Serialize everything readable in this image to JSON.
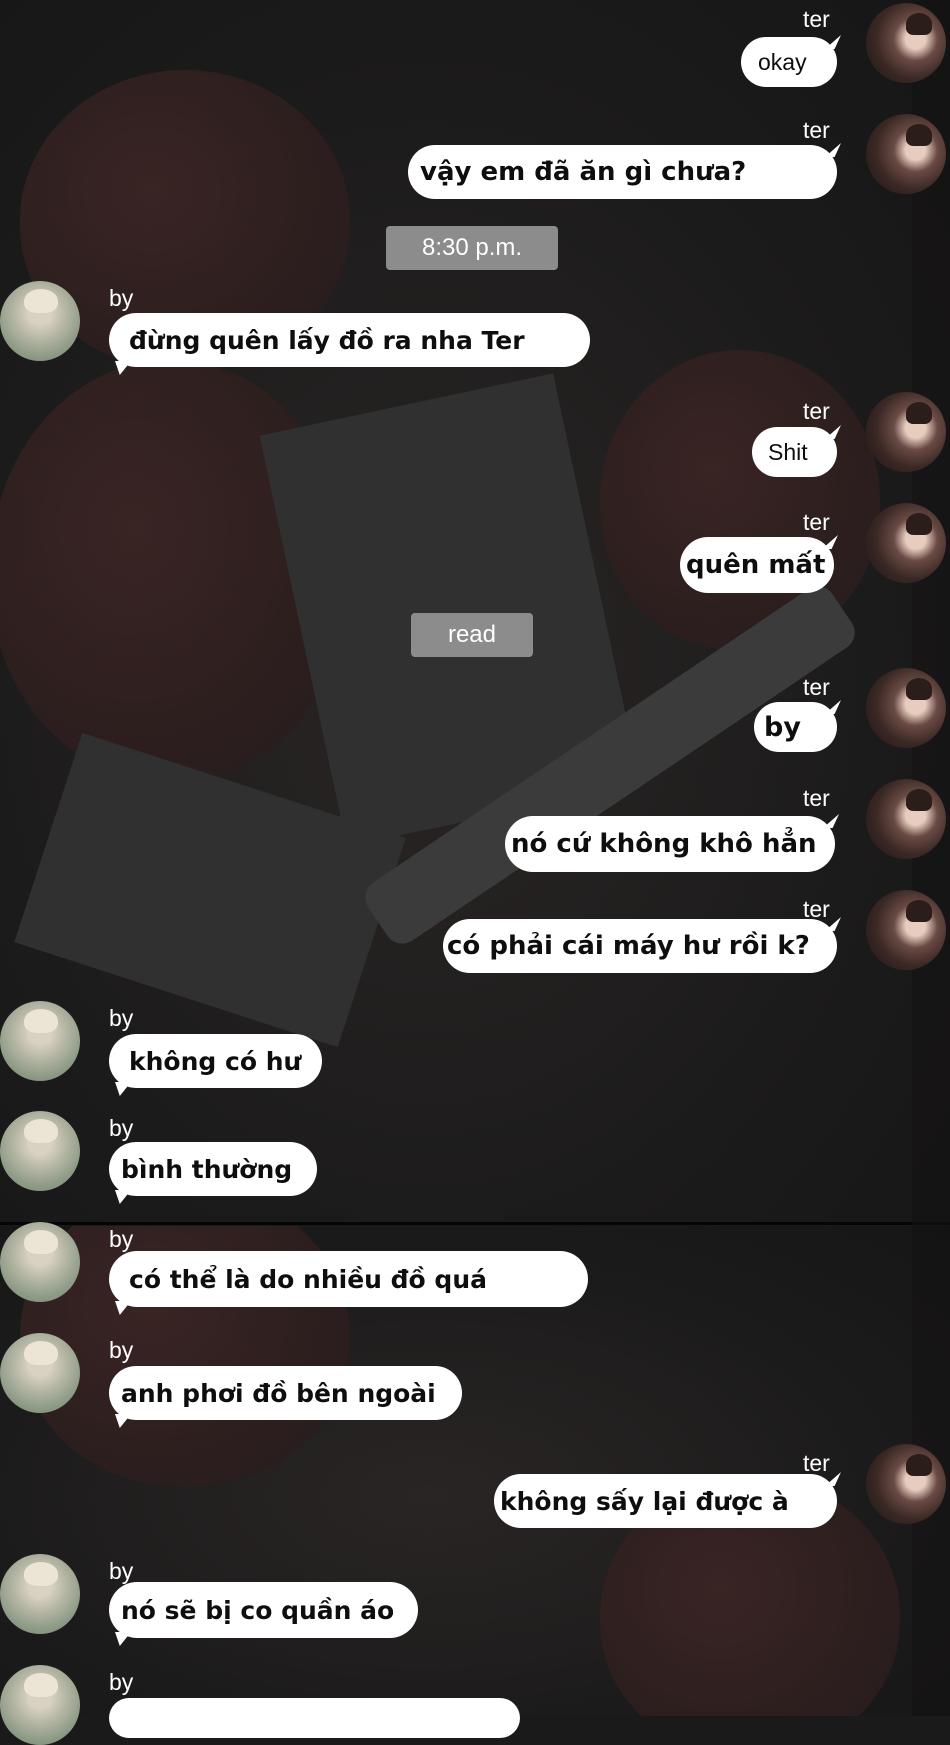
{
  "colors": {
    "bubble": "#ffffff",
    "bubble_text": "#0e0e0e",
    "stamp": "#8c8c8c",
    "name_text": "#ffffff"
  },
  "icons": {
    "ter_avatar": "avatar-ter-icon",
    "by_avatar": "avatar-by-icon"
  },
  "timestamp": "8:30 p.m.",
  "read_receipt": "read",
  "messages": [
    {
      "sender": "ter",
      "text": "okay"
    },
    {
      "sender": "ter",
      "text": "vậy em đã ăn gì chưa?"
    },
    {
      "sender": "by",
      "text": "đừng quên lấy đồ ra nha Ter"
    },
    {
      "sender": "ter",
      "text": "Shit"
    },
    {
      "sender": "ter",
      "text": "quên mất"
    },
    {
      "sender": "ter",
      "text": "by"
    },
    {
      "sender": "ter",
      "text": "nó cứ không khô hẳn"
    },
    {
      "sender": "ter",
      "text": "có phải cái máy hư rồi k?"
    },
    {
      "sender": "by",
      "text": "không có hư"
    },
    {
      "sender": "by",
      "text": "bình thường"
    },
    {
      "sender": "by",
      "text": "có thể là do nhiều đồ quá"
    },
    {
      "sender": "by",
      "text": "anh phơi đồ bên ngoài"
    },
    {
      "sender": "ter",
      "text": "không sấy lại được à"
    },
    {
      "sender": "by",
      "text": "nó sẽ bị co quần áo"
    },
    {
      "sender": "by",
      "text": ""
    }
  ]
}
